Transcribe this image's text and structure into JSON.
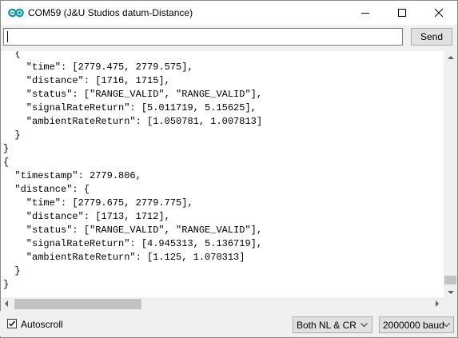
{
  "window": {
    "title": "COM59 (J&U Studios datum-Distance)",
    "controls": {
      "minimize": "minimize-icon",
      "maximize": "maximize-icon",
      "close": "close-icon"
    }
  },
  "input": {
    "value": "",
    "placeholder": ""
  },
  "toolbar": {
    "send_label": "Send"
  },
  "output": {
    "lines": [
      "  {",
      "    \"time\": [2779.475, 2779.575],",
      "    \"distance\": [1716, 1715],",
      "    \"status\": [\"RANGE_VALID\", \"RANGE_VALID\"],",
      "    \"signalRateReturn\": [5.011719, 5.15625],",
      "    \"ambientRateReturn\": [1.050781, 1.007813]",
      "  }",
      "}",
      "{",
      "  \"timestamp\": 2779.806,",
      "  \"distance\": {",
      "    \"time\": [2779.675, 2779.775],",
      "    \"distance\": [1713, 1712],",
      "    \"status\": [\"RANGE_VALID\", \"RANGE_VALID\"],",
      "    \"signalRateReturn\": [4.945313, 5.136719],",
      "    \"ambientRateReturn\": [1.125, 1.070313]",
      "  }",
      "}"
    ]
  },
  "footer": {
    "autoscroll_label": "Autoscroll",
    "autoscroll_checked": true,
    "line_ending": "Both NL & CR",
    "baud_rate": "2000000 baud"
  },
  "colors": {
    "app_icon": "#00979c",
    "window_bg": "#f0f0f0"
  }
}
